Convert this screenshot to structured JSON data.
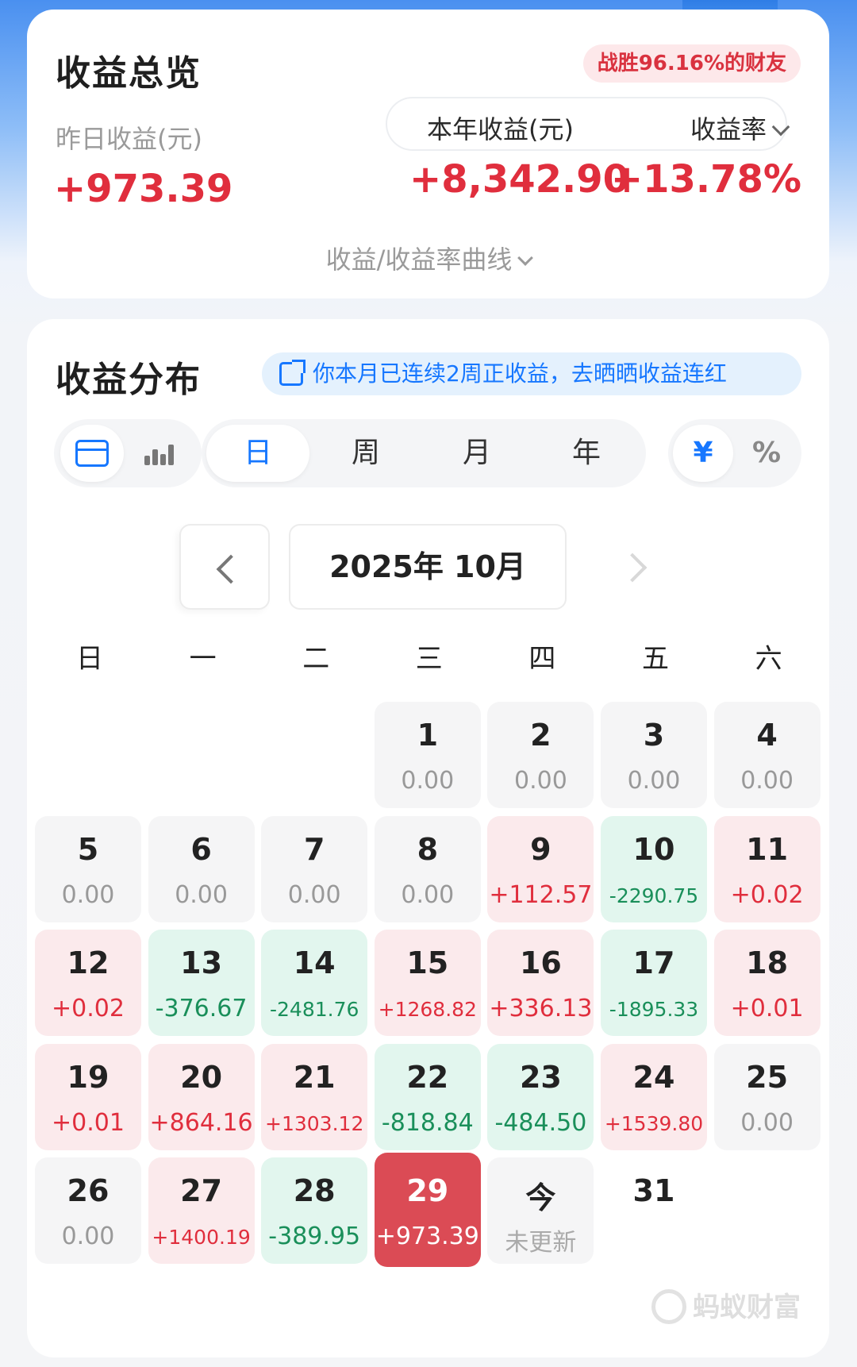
{
  "overview": {
    "title": "收益总览",
    "rank_badge": "战胜96.16%的财友",
    "yesterday_label": "昨日收益(元)",
    "yesterday_value": "+973.39",
    "year_label": "本年收益(元)",
    "year_value": "+8,342.90",
    "rate_label": "收益率",
    "rate_value": "+13.78%",
    "curve_toggle": "收益/收益率曲线"
  },
  "distribution": {
    "title": "收益分布",
    "streak_banner": "你本月已连续2周正收益，去晒晒收益连红",
    "period_tabs": [
      "日",
      "周",
      "月",
      "年"
    ],
    "active_period": "日",
    "unit_tabs": [
      "¥",
      "%"
    ],
    "active_unit": "¥",
    "active_view": "calendar",
    "month": "2025年 10月",
    "weekdays": [
      "日",
      "一",
      "二",
      "三",
      "四",
      "五",
      "六"
    ],
    "first_weekday_index": 3,
    "days": [
      {
        "day": "1",
        "value": "0.00",
        "type": "zero"
      },
      {
        "day": "2",
        "value": "0.00",
        "type": "zero"
      },
      {
        "day": "3",
        "value": "0.00",
        "type": "zero"
      },
      {
        "day": "4",
        "value": "0.00",
        "type": "zero"
      },
      {
        "day": "5",
        "value": "0.00",
        "type": "zero"
      },
      {
        "day": "6",
        "value": "0.00",
        "type": "zero"
      },
      {
        "day": "7",
        "value": "0.00",
        "type": "zero"
      },
      {
        "day": "8",
        "value": "0.00",
        "type": "zero"
      },
      {
        "day": "9",
        "value": "+112.57",
        "type": "pos"
      },
      {
        "day": "10",
        "value": "-2290.75",
        "type": "neg"
      },
      {
        "day": "11",
        "value": "+0.02",
        "type": "pos"
      },
      {
        "day": "12",
        "value": "+0.02",
        "type": "pos"
      },
      {
        "day": "13",
        "value": "-376.67",
        "type": "neg"
      },
      {
        "day": "14",
        "value": "-2481.76",
        "type": "neg"
      },
      {
        "day": "15",
        "value": "+1268.82",
        "type": "pos"
      },
      {
        "day": "16",
        "value": "+336.13",
        "type": "pos"
      },
      {
        "day": "17",
        "value": "-1895.33",
        "type": "neg"
      },
      {
        "day": "18",
        "value": "+0.01",
        "type": "pos"
      },
      {
        "day": "19",
        "value": "+0.01",
        "type": "pos"
      },
      {
        "day": "20",
        "value": "+864.16",
        "type": "pos"
      },
      {
        "day": "21",
        "value": "+1303.12",
        "type": "pos"
      },
      {
        "day": "22",
        "value": "-818.84",
        "type": "neg"
      },
      {
        "day": "23",
        "value": "-484.50",
        "type": "neg"
      },
      {
        "day": "24",
        "value": "+1539.80",
        "type": "pos"
      },
      {
        "day": "25",
        "value": "0.00",
        "type": "zero"
      },
      {
        "day": "26",
        "value": "0.00",
        "type": "zero"
      },
      {
        "day": "27",
        "value": "+1400.19",
        "type": "pos"
      },
      {
        "day": "28",
        "value": "-389.95",
        "type": "neg"
      },
      {
        "day": "29",
        "value": "+973.39",
        "type": "selected"
      },
      {
        "day": "今",
        "value": "未更新",
        "type": "today"
      },
      {
        "day": "31",
        "value": "",
        "type": "blank"
      }
    ],
    "brand": "蚂蚁财富"
  },
  "colors": {
    "positive": "#e02e3d",
    "negative": "#1a8f5a",
    "accent": "#1677ff",
    "selected": "#db4b55"
  }
}
